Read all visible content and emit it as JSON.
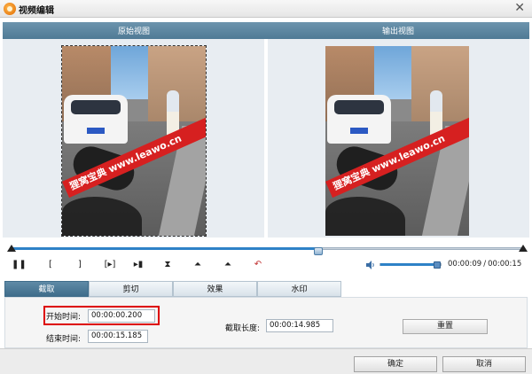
{
  "window": {
    "title": "视频编辑"
  },
  "views": {
    "original_label": "原始视图",
    "output_label": "输出视图"
  },
  "video": {
    "watermark_text": "狸窝宝典 www.leawo.cn"
  },
  "timeline": {
    "progress": 0.6,
    "volume": 0.92
  },
  "time": {
    "current": "00:00:09",
    "separator": "/",
    "total": "00:00:15"
  },
  "controls": {
    "items": [
      {
        "name": "pause-button",
        "glyph": "❚❚"
      },
      {
        "name": "set-start-button",
        "glyph": "["
      },
      {
        "name": "set-end-button",
        "glyph": "]"
      },
      {
        "name": "play-selection-button",
        "glyph": "[▸]"
      },
      {
        "name": "next-frame-button",
        "glyph": "▸▮"
      },
      {
        "name": "trim-icon-button",
        "glyph": "⧗"
      },
      {
        "name": "mark-in-button",
        "glyph": "⏶"
      },
      {
        "name": "mark-out-button",
        "glyph": "⏶"
      },
      {
        "name": "undo-button",
        "glyph": "↶"
      }
    ]
  },
  "tabs": [
    {
      "label": "截取",
      "active": true
    },
    {
      "label": "剪切",
      "active": false
    },
    {
      "label": "效果",
      "active": false
    },
    {
      "label": "水印",
      "active": false
    }
  ],
  "trim": {
    "start_label": "开始时间:",
    "start_value": "00:00:00.200",
    "end_label": "结束时间:",
    "end_value": "00:00:15.185",
    "length_label": "截取长度:",
    "length_value": "00:00:14.985",
    "reset_label": "重置"
  },
  "footer": {
    "ok_label": "确定",
    "cancel_label": "取消"
  },
  "colors": {
    "accent": "#2e82c7",
    "header": "#4f7a95",
    "highlight": "#dd0000",
    "watermark": "#d62020"
  }
}
